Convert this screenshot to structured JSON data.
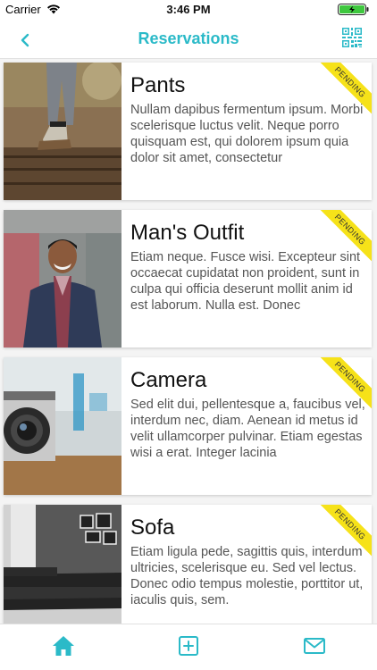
{
  "status_bar": {
    "carrier": "Carrier",
    "time": "3:46 PM"
  },
  "nav": {
    "title": "Reservations",
    "back_icon": "chevron-left-icon",
    "action_icon": "qr-code-icon"
  },
  "colors": {
    "accent": "#2bbac8",
    "ribbon": "#f6e219"
  },
  "reservations": [
    {
      "title": "Pants",
      "description": "Nullam dapibus fermentum ipsum. Morbi scelerisque luctus velit. Neque porro quisquam est, qui dolorem ipsum quia dolor sit amet, consectetur",
      "status": "PENDING"
    },
    {
      "title": "Man's Outfit",
      "description": "Etiam neque. Fusce wisi. Excepteur sint occaecat cupidatat non proident, sunt in culpa qui officia deserunt mollit anim id est laborum. Nulla est. Donec",
      "status": "PENDING"
    },
    {
      "title": "Camera",
      "description": "Sed elit dui, pellentesque a, faucibus vel, interdum nec, diam. Aenean id metus id velit ullamcorper pulvinar. Etiam egestas wisi a erat. Integer lacinia",
      "status": "PENDING"
    },
    {
      "title": "Sofa",
      "description": "Etiam ligula pede, sagittis quis, interdum ultricies, scelerisque eu. Sed vel lectus. Donec odio tempus molestie, porttitor ut, iaculis quis, sem.",
      "status": "PENDING"
    }
  ],
  "tabs": [
    {
      "icon": "home-icon"
    },
    {
      "icon": "add-square-icon"
    },
    {
      "icon": "mail-icon"
    }
  ]
}
